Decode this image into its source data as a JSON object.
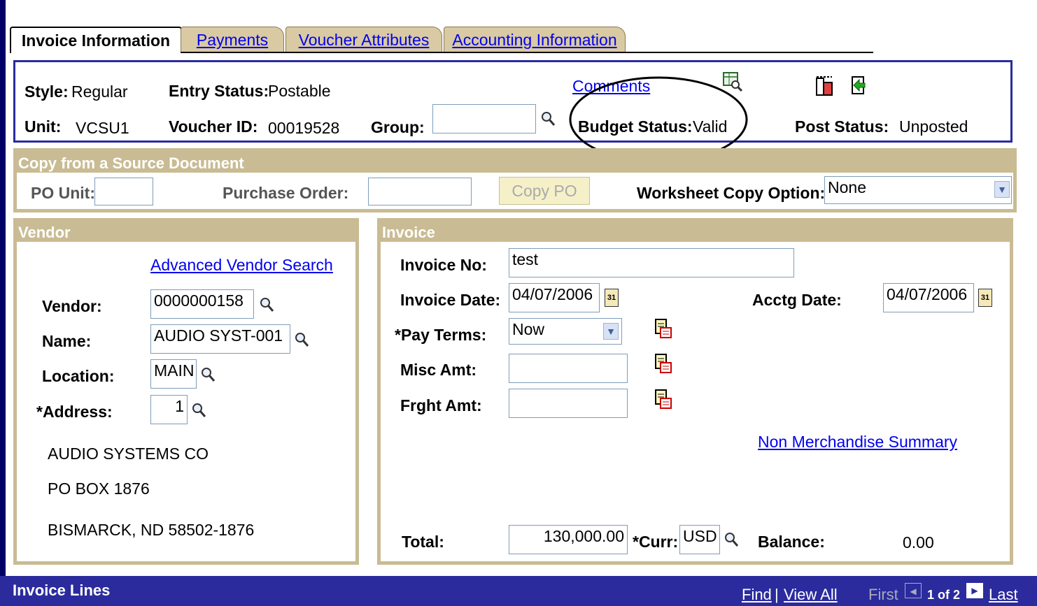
{
  "tabs": [
    {
      "label": "Invoice Information",
      "active": true
    },
    {
      "label": "Payments",
      "active": false
    },
    {
      "label": "Voucher Attributes",
      "active": false
    },
    {
      "label": "Accounting Information",
      "active": false
    }
  ],
  "header": {
    "style_label": "Style:",
    "style_value": "Regular",
    "entry_status_label": "Entry Status:",
    "entry_status_value": "Postable",
    "comments_link": "Comments",
    "unit_label": "Unit:",
    "unit_value": "VCSU1",
    "voucher_id_label": "Voucher ID:",
    "voucher_id_value": "00019528",
    "group_label": "Group:",
    "group_value": "",
    "budget_status_label": "Budget Status:",
    "budget_status_value": "Valid",
    "post_status_label": "Post Status:",
    "post_status_value": "Unposted"
  },
  "copy_source": {
    "title": "Copy from a Source Document",
    "po_unit_label": "PO Unit:",
    "po_unit_value": "",
    "purchase_order_label": "Purchase Order:",
    "purchase_order_value": "",
    "copy_po_button": "Copy PO",
    "worksheet_label": "Worksheet Copy Option:",
    "worksheet_value": "None"
  },
  "vendor": {
    "title": "Vendor",
    "advanced_search_link": "Advanced Vendor Search",
    "vendor_label": "Vendor:",
    "vendor_value": "0000000158",
    "name_label": "Name:",
    "name_value": "AUDIO SYST-001",
    "location_label": "Location:",
    "location_value": "MAIN",
    "address_label": "*Address:",
    "address_value": "1",
    "address_lines": [
      "AUDIO SYSTEMS CO",
      "PO BOX 1876",
      "BISMARCK, ND  58502-1876"
    ]
  },
  "invoice": {
    "title": "Invoice",
    "invoice_no_label": "Invoice No:",
    "invoice_no_value": "test",
    "invoice_date_label": "Invoice Date:",
    "invoice_date_value": "04/07/2006",
    "acctg_date_label": "Acctg Date:",
    "acctg_date_value": "04/07/2006",
    "pay_terms_label": "*Pay Terms:",
    "pay_terms_value": "Now",
    "misc_amt_label": "Misc Amt:",
    "misc_amt_value": "",
    "frght_amt_label": "Frght Amt:",
    "frght_amt_value": "",
    "non_merch_link": "Non Merchandise Summary",
    "total_label": "Total:",
    "total_value": "130,000.00",
    "curr_label": "*Curr:",
    "curr_value": "USD",
    "balance_label": "Balance:",
    "balance_value": "0.00",
    "calendar_icon_text": "31"
  },
  "invoice_lines": {
    "title": "Invoice Lines",
    "find_link": "Find",
    "separator": "|",
    "view_all_link": "View All",
    "first_label": "First",
    "page_indicator": "1 of 2",
    "last_link": "Last"
  },
  "colors": {
    "frame": "#000066",
    "header_border": "#2b2b9e",
    "group_box": "#c9bb93",
    "link": "#0000ee",
    "tab_inactive": "#d9caa3",
    "annotation_ellipse": "#000000"
  }
}
